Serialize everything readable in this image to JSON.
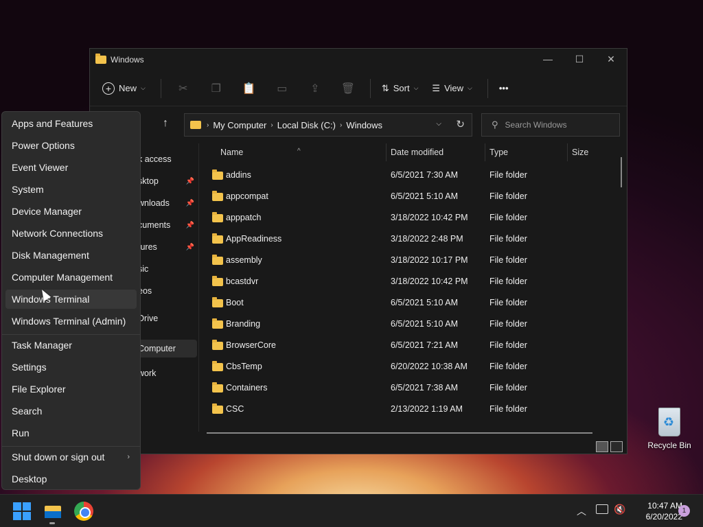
{
  "window": {
    "title": "Windows",
    "controls": {
      "minimize": "—",
      "maximize": "☐",
      "close": "✕"
    }
  },
  "toolbar": {
    "new_label": "New",
    "sort_label": "Sort",
    "view_label": "View",
    "more_label": "•••"
  },
  "address": {
    "crumbs": [
      "My Computer",
      "Local Disk (C:)",
      "Windows"
    ]
  },
  "search": {
    "placeholder": "Search Windows"
  },
  "sidebar": {
    "items": [
      {
        "label": "k access",
        "pinned": false
      },
      {
        "label": "sktop",
        "pinned": true
      },
      {
        "label": "wnloads",
        "pinned": true
      },
      {
        "label": "cuments",
        "pinned": true
      },
      {
        "label": "tures",
        "pinned": true
      },
      {
        "label": "sic",
        "pinned": false
      },
      {
        "label": "eos",
        "pinned": false
      },
      {
        "label": "Drive",
        "pinned": false
      },
      {
        "label": "Computer",
        "pinned": false,
        "selected": true
      },
      {
        "label": "work",
        "pinned": false
      }
    ]
  },
  "columns": {
    "name": "Name",
    "date": "Date modified",
    "type": "Type",
    "size": "Size"
  },
  "files": [
    {
      "name": "addins",
      "date": "6/5/2021 7:30 AM",
      "type": "File folder"
    },
    {
      "name": "appcompat",
      "date": "6/5/2021 5:10 AM",
      "type": "File folder"
    },
    {
      "name": "apppatch",
      "date": "3/18/2022 10:42 PM",
      "type": "File folder"
    },
    {
      "name": "AppReadiness",
      "date": "3/18/2022 2:48 PM",
      "type": "File folder"
    },
    {
      "name": "assembly",
      "date": "3/18/2022 10:17 PM",
      "type": "File folder"
    },
    {
      "name": "bcastdvr",
      "date": "3/18/2022 10:42 PM",
      "type": "File folder"
    },
    {
      "name": "Boot",
      "date": "6/5/2021 5:10 AM",
      "type": "File folder"
    },
    {
      "name": "Branding",
      "date": "6/5/2021 5:10 AM",
      "type": "File folder"
    },
    {
      "name": "BrowserCore",
      "date": "6/5/2021 7:21 AM",
      "type": "File folder"
    },
    {
      "name": "CbsTemp",
      "date": "6/20/2022 10:38 AM",
      "type": "File folder"
    },
    {
      "name": "Containers",
      "date": "6/5/2021 7:38 AM",
      "type": "File folder"
    },
    {
      "name": "CSC",
      "date": "2/13/2022 1:19 AM",
      "type": "File folder"
    }
  ],
  "context_menu": {
    "group1": [
      "Apps and Features",
      "Power Options",
      "Event Viewer",
      "System",
      "Device Manager",
      "Network Connections",
      "Disk Management",
      "Computer Management",
      "Windows Terminal",
      "Windows Terminal (Admin)"
    ],
    "group2": [
      "Task Manager",
      "Settings",
      "File Explorer",
      "Search",
      "Run"
    ],
    "group3": [
      "Shut down or sign out",
      "Desktop"
    ],
    "hovered": "Windows Terminal"
  },
  "desktop": {
    "recycle_bin_label": "Recycle Bin"
  },
  "taskbar": {
    "time": "10:47 AM",
    "date": "6/20/2022",
    "notification_count": "1",
    "icons": [
      "windows-start-icon",
      "file-explorer-icon",
      "chrome-icon"
    ]
  },
  "colors": {
    "folder": "#f3c34c",
    "accent": "#3aa0ff"
  }
}
